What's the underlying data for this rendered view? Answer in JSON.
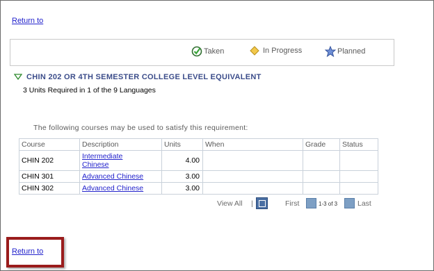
{
  "links": {
    "return_top": "Return to",
    "return_bottom": "Return to"
  },
  "legend": {
    "taken": "Taken",
    "in_progress": "In Progress",
    "planned": "Planned"
  },
  "requirement": {
    "title": "CHIN 202 OR 4TH SEMESTER COLLEGE LEVEL EQUIVALENT",
    "subtitle": "3 Units Required in 1 of the 9 Languages"
  },
  "courses_note": "The following courses may be used to satisfy this requirement:",
  "table": {
    "headers": {
      "course": "Course",
      "description": "Description",
      "units": "Units",
      "when": "When",
      "grade": "Grade",
      "status": "Status"
    },
    "rows": [
      {
        "course": "CHIN 202",
        "description_line1": "Intermediate",
        "description_line2": "Chinese",
        "units": "4.00"
      },
      {
        "course": "CHIN 301",
        "description": "Advanced Chinese",
        "units": "3.00"
      },
      {
        "course": "CHIN 302",
        "description": "Advanced Chinese",
        "units": "3.00"
      }
    ]
  },
  "nav": {
    "view_all": "View All",
    "separator": "|",
    "first": "First",
    "range": "1-3 of 3",
    "last": "Last"
  },
  "colors": {
    "link": "#2222cc",
    "title": "#3b4c8a",
    "highlight": "#9a1c1c"
  },
  "icons": {
    "taken": "check-circle-icon",
    "in_progress": "diamond-icon",
    "planned": "star-icon"
  }
}
